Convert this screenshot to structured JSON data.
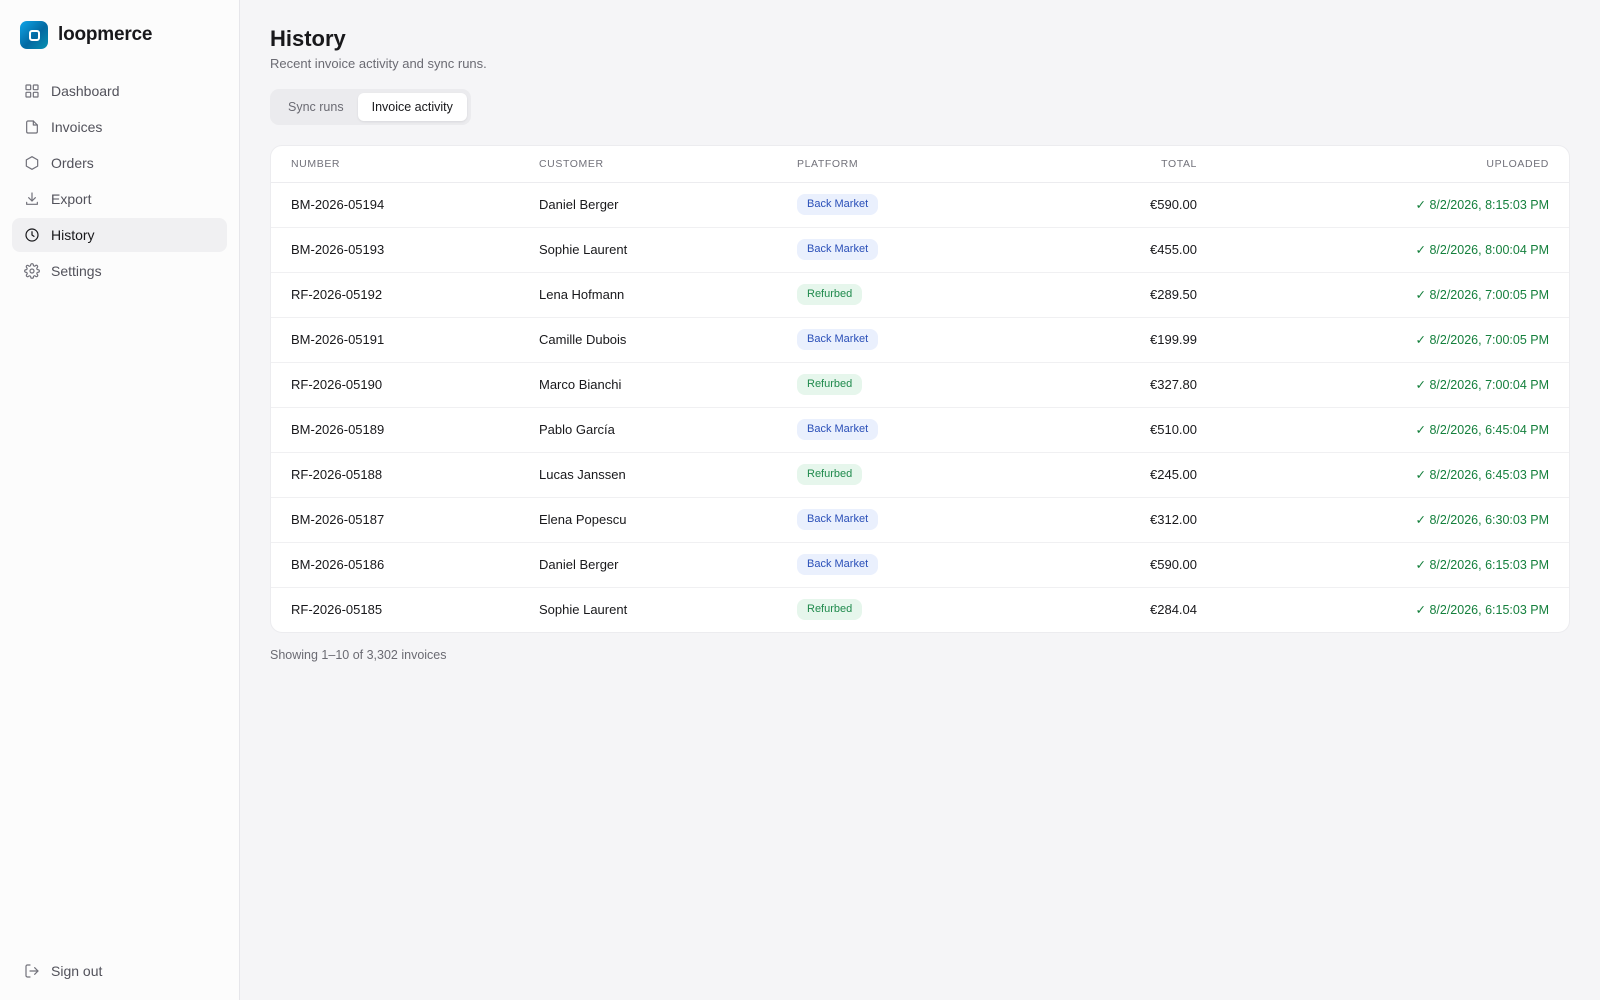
{
  "brand": {
    "name": "loopmerce"
  },
  "nav": {
    "items": [
      {
        "label": "Dashboard",
        "icon": "grid-icon"
      },
      {
        "label": "Invoices",
        "icon": "file-icon"
      },
      {
        "label": "Orders",
        "icon": "box-icon"
      },
      {
        "label": "Export",
        "icon": "download-icon"
      },
      {
        "label": "History",
        "icon": "clock-icon",
        "active": true
      },
      {
        "label": "Settings",
        "icon": "gear-icon"
      }
    ],
    "sign_out": "Sign out"
  },
  "page": {
    "title": "History",
    "subtitle": "Recent invoice activity and sync runs."
  },
  "tabs": [
    {
      "label": "Sync runs",
      "active": false
    },
    {
      "label": "Invoice activity",
      "active": true
    }
  ],
  "table": {
    "columns": [
      "NUMBER",
      "CUSTOMER",
      "PLATFORM",
      "TOTAL",
      "UPLOADED"
    ],
    "rows": [
      {
        "number": "BM-2026-05194",
        "customer": "Daniel Berger",
        "platform": "Back Market",
        "total": "€590.00",
        "uploaded": "✓ 8/2/2026, 8:15:03 PM"
      },
      {
        "number": "BM-2026-05193",
        "customer": "Sophie Laurent",
        "platform": "Back Market",
        "total": "€455.00",
        "uploaded": "✓ 8/2/2026, 8:00:04 PM"
      },
      {
        "number": "RF-2026-05192",
        "customer": "Lena Hofmann",
        "platform": "Refurbed",
        "total": "€289.50",
        "uploaded": "✓ 8/2/2026, 7:00:05 PM"
      },
      {
        "number": "BM-2026-05191",
        "customer": "Camille Dubois",
        "platform": "Back Market",
        "total": "€199.99",
        "uploaded": "✓ 8/2/2026, 7:00:05 PM"
      },
      {
        "number": "RF-2026-05190",
        "customer": "Marco Bianchi",
        "platform": "Refurbed",
        "total": "€327.80",
        "uploaded": "✓ 8/2/2026, 7:00:04 PM"
      },
      {
        "number": "BM-2026-05189",
        "customer": "Pablo García",
        "platform": "Back Market",
        "total": "€510.00",
        "uploaded": "✓ 8/2/2026, 6:45:04 PM"
      },
      {
        "number": "RF-2026-05188",
        "customer": "Lucas Janssen",
        "platform": "Refurbed",
        "total": "€245.00",
        "uploaded": "✓ 8/2/2026, 6:45:03 PM"
      },
      {
        "number": "BM-2026-05187",
        "customer": "Elena Popescu",
        "platform": "Back Market",
        "total": "€312.00",
        "uploaded": "✓ 8/2/2026, 6:30:03 PM"
      },
      {
        "number": "BM-2026-05186",
        "customer": "Daniel Berger",
        "platform": "Back Market",
        "total": "€590.00",
        "uploaded": "✓ 8/2/2026, 6:15:03 PM"
      },
      {
        "number": "RF-2026-05185",
        "customer": "Sophie Laurent",
        "platform": "Refurbed",
        "total": "€284.04",
        "uploaded": "✓ 8/2/2026, 6:15:03 PM"
      }
    ]
  },
  "footer": {
    "showing": "Showing 1–10 of 3,302 invoices"
  },
  "colors": {
    "accent": "#0284c7",
    "back_market_badge": "#eaf0fd",
    "refurbed_badge": "#e6f6ec",
    "uploaded_green": "#15803d"
  }
}
